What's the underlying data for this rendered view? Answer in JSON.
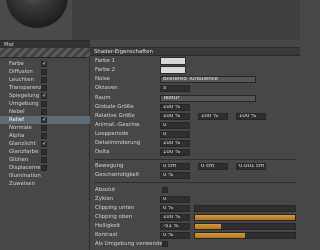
{
  "material": {
    "name": "Mat"
  },
  "channels": [
    {
      "label": "Farbe",
      "checked": true
    },
    {
      "label": "Diffusion",
      "checked": false
    },
    {
      "label": "Leuchten",
      "checked": false
    },
    {
      "label": "Transparenz",
      "checked": false
    },
    {
      "label": "Spiegelung",
      "checked": true
    },
    {
      "label": "Umgebung",
      "checked": false
    },
    {
      "label": "Nebel",
      "checked": false
    },
    {
      "label": "Relief",
      "checked": true,
      "selected": true
    },
    {
      "label": "Normale",
      "checked": false
    },
    {
      "label": "Alpha",
      "checked": false
    },
    {
      "label": "Glanzlicht",
      "checked": true
    },
    {
      "label": "Glanzfarbe",
      "checked": false
    },
    {
      "label": "Glühen",
      "checked": false
    },
    {
      "label": "Displacement",
      "checked": false
    },
    {
      "label": "Illumination",
      "checked": null
    },
    {
      "label": "Zuweisen",
      "checked": null
    }
  ],
  "shader": {
    "header": "Shader-Eigenschaften",
    "farbe1": "Farbe 1",
    "farbe2": "Farbe 2",
    "noise_label": "Noise",
    "noise_value": "Blistered Turbulence",
    "oktaven_label": "Oktaven",
    "oktaven_value": "5",
    "raum_label": "Raum",
    "raum_value": "Textur",
    "globale_label": "Globale Größe",
    "globale_value": "100 %",
    "relative_label": "Relative Größe",
    "relative_values": [
      "100 %",
      "100 %",
      "100 %"
    ],
    "animat_label": "Animat.-Geschw.",
    "animat_value": "0",
    "loop_label": "Loopperiode",
    "loop_value": "0",
    "detail_label": "Detailminderung",
    "detail_value": "100 %",
    "delta_label": "Delta",
    "delta_value": "100 %",
    "bewegung_label": "Bewegung",
    "bewegung_values": [
      "0 cm",
      "0 cm",
      "0.001 cm"
    ],
    "geschw_label": "Geschwindigkeit",
    "geschw_value": "0 %",
    "absolut_label": "Absolut",
    "zyklen_label": "Zyklen",
    "zyklen_value": "0",
    "clip_unten_label": "Clipping unten",
    "clip_unten_value": "0 %",
    "clip_unten_fill": 0.0,
    "clip_oben_label": "Clipping oben",
    "clip_oben_value": "100 %",
    "clip_oben_fill": 1.0,
    "helligkeit_label": "Helligkeit",
    "helligkeit_value": "-51 %",
    "helligkeit_fill": 0.26,
    "kontrast_label": "Kontrast",
    "kontrast_value": "0 %",
    "kontrast_fill": 0.5,
    "umgebung_label": "Als Umgebung verwenden"
  },
  "colors": {
    "accent": "#d49a3a",
    "selection": "#5f6a73"
  }
}
